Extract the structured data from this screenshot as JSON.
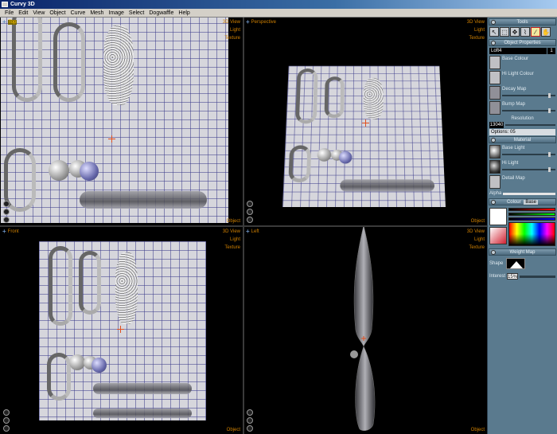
{
  "window": {
    "title": "Curvy 3D"
  },
  "menu": [
    "File",
    "Edit",
    "View",
    "Object",
    "Curve",
    "Mesh",
    "Image",
    "Select",
    "Dogwaffle",
    "Help"
  ],
  "viewports": {
    "top": {
      "label": "Top",
      "menu": [
        "3D View",
        "Light",
        "Texture"
      ],
      "object": "Object"
    },
    "perspective": {
      "label": "Perspective",
      "menu": [
        "3D View",
        "Light",
        "Texture"
      ],
      "object": "Object"
    },
    "front": {
      "label": "Front",
      "menu": [
        "3D View",
        "Light",
        "Texture"
      ],
      "object": "Object"
    },
    "left": {
      "label": "Left",
      "menu": [
        "3D View",
        "Light",
        "Texture"
      ],
      "object": "Object"
    }
  },
  "panel": {
    "tools_title": "Tools",
    "object_props_title": "Object Properties",
    "object_name": "Loft4",
    "object_index": "1",
    "slots": [
      {
        "label": "Base Colour"
      },
      {
        "label": "Hi Light Colour"
      },
      {
        "label": "Decay Map"
      },
      {
        "label": "Bump Map"
      }
    ],
    "resolution_label": "Resolution",
    "resolution_value": "13040",
    "options_label": "Options: 05",
    "material_title": "Material",
    "material_slots": [
      {
        "label": "Base Light"
      },
      {
        "label": "Hi Light"
      },
      {
        "label": "Detail Map"
      }
    ],
    "alpha_label": "Alpha",
    "colour_title": "Colour",
    "colour_mode": "Base",
    "weight_title": "Weight Map",
    "shape_label": "Shape",
    "interest_label": "Interest",
    "interest_value": "15%"
  },
  "colors": {
    "panel": "#5a7a8e",
    "viewport_label": "#d08000",
    "mesh_grid": "#3c3c8c"
  }
}
